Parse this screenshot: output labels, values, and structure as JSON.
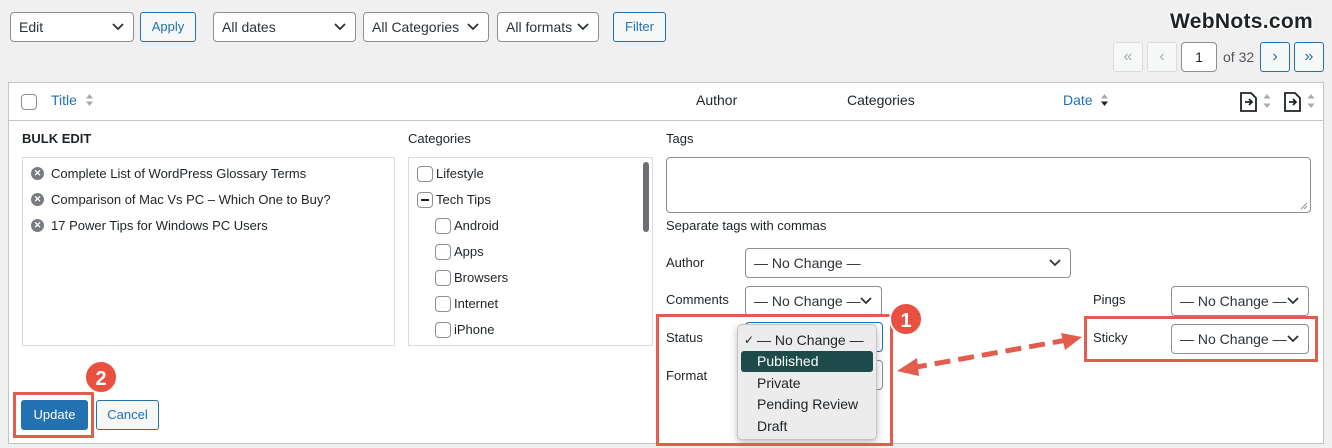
{
  "brand": "WebNots.com",
  "toolbar": {
    "bulk_action": "Edit",
    "apply_label": "Apply",
    "dates": "All dates",
    "categories": "All Categories",
    "formats": "All formats",
    "filter_label": "Filter"
  },
  "pagination": {
    "first": "«",
    "prev": "‹",
    "current_page": "1",
    "of_text": "of 32",
    "next": "›",
    "last": "»"
  },
  "table_header": {
    "title": "Title",
    "author": "Author",
    "categories": "Categories",
    "date": "Date"
  },
  "bulk_edit": {
    "heading": "BULK EDIT",
    "posts": [
      "Complete List of WordPress Glossary Terms",
      "Comparison of Mac Vs PC – Which One to Buy?",
      "17 Power Tips for Windows PC Users"
    ],
    "categories_label": "Categories",
    "categories": [
      {
        "label": "Lifestyle"
      },
      {
        "label": "Tech Tips"
      },
      {
        "label": "Android"
      },
      {
        "label": "Apps"
      },
      {
        "label": "Browsers"
      },
      {
        "label": "Internet"
      },
      {
        "label": "iPhone"
      }
    ],
    "tags_label": "Tags",
    "tags_hint": "Separate tags with commas",
    "author_label": "Author",
    "author_value": "— No Change —",
    "comments_label": "Comments",
    "comments_value": "— No Change —",
    "pings_label": "Pings",
    "pings_value": "— No Change —",
    "status_label": "Status",
    "sticky_label": "Sticky",
    "sticky_value": "— No Change —",
    "format_label": "Format",
    "status_options": [
      "— No Change —",
      "Published",
      "Private",
      "Pending Review",
      "Draft"
    ],
    "status_selected_check": "✓",
    "update_label": "Update",
    "cancel_label": "Cancel"
  },
  "annotations": {
    "badge_1": "1",
    "badge_2": "2"
  },
  "colors": {
    "accent": "#2271b1",
    "highlight": "#e35d4f",
    "dropdown_active": "#1d4b4b"
  }
}
